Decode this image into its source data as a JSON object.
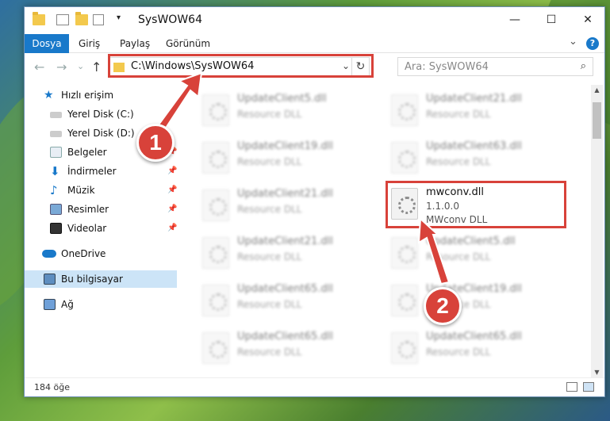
{
  "window": {
    "title": "SysWOW64",
    "minimize": "—",
    "maximize": "☐",
    "close": "✕"
  },
  "ribbon": {
    "tabs": [
      "Dosya",
      "Giriş",
      "Paylaş",
      "Görünüm"
    ],
    "collapse": "⌄",
    "help": "?"
  },
  "nav": {
    "back": "←",
    "forward": "→",
    "recent": "⌄",
    "up": "↑",
    "address": "C:\\Windows\\SysWOW64",
    "address_drop": "⌄",
    "refresh": "↻",
    "search_placeholder": "Ara: SysWOW64",
    "search_icon": "⌕"
  },
  "sidebar": {
    "items": [
      {
        "label": "Hızlı erişim",
        "icon": "star-icon"
      },
      {
        "label": "Yerel Disk (C:)",
        "icon": "drive-icon"
      },
      {
        "label": "Yerel Disk (D:)",
        "icon": "drive-icon"
      },
      {
        "label": "Belgeler",
        "icon": "documents-icon"
      },
      {
        "label": "İndirmeler",
        "icon": "download-icon"
      },
      {
        "label": "Müzik",
        "icon": "music-icon"
      },
      {
        "label": "Resimler",
        "icon": "pictures-icon"
      },
      {
        "label": "Videolar",
        "icon": "video-icon"
      },
      {
        "label": "OneDrive",
        "icon": "cloud-icon"
      },
      {
        "label": "Bu bilgisayar",
        "icon": "computer-icon"
      },
      {
        "label": "Ağ",
        "icon": "network-icon"
      }
    ]
  },
  "files": {
    "left": [
      {
        "name": "UpdateClient5.dll",
        "sub": "Resource DLL"
      },
      {
        "name": "UpdateClient19.dll",
        "sub": "Resource DLL"
      },
      {
        "name": "UpdateClient21.dll",
        "sub": "Resource DLL"
      },
      {
        "name": "UpdateClient21.dll",
        "sub": "Resource DLL"
      },
      {
        "name": "UpdateClient65.dll",
        "sub": "Resource DLL"
      },
      {
        "name": "UpdateClient65.dll",
        "sub": "Resource DLL"
      }
    ],
    "right": [
      {
        "name": "UpdateClient21.dll",
        "sub": "Resource DLL"
      },
      {
        "name": "UpdateClient63.dll",
        "sub": "Resource DLL"
      },
      {
        "name": "UpdateClient5.dll",
        "sub": "Resource DLL"
      },
      {
        "name": "UpdateClient19.dll",
        "sub": "Resource DLL"
      },
      {
        "name": "UpdateClient65.dll",
        "sub": "Resource DLL"
      }
    ],
    "highlighted": {
      "name": "mwconv.dll",
      "version": "1.1.0.0",
      "desc": "MWconv DLL"
    }
  },
  "status": {
    "count": "184 öğe"
  },
  "callouts": [
    "1",
    "2"
  ],
  "colors": {
    "accent": "#1979ca",
    "callout": "#d8423a"
  }
}
